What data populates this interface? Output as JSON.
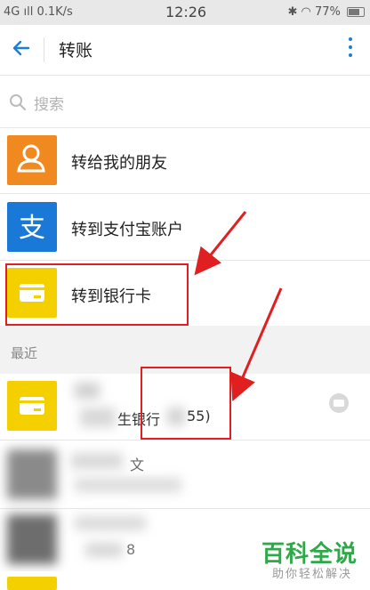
{
  "status_bar": {
    "left": "4G ıll 0.1K/s",
    "time": "12:26",
    "right": "77%"
  },
  "header": {
    "title": "转账"
  },
  "search": {
    "placeholder": "搜索"
  },
  "options": [
    {
      "label": "转给我的朋友",
      "icon": "person-icon",
      "color": "#f0891f"
    },
    {
      "label": "转到支付宝账户",
      "icon": "alipay-icon",
      "color": "#1a78d6"
    },
    {
      "label": "转到银行卡",
      "icon": "bank-card-icon",
      "color": "#f5d000"
    }
  ],
  "recent": {
    "heading": "最近",
    "items": [
      {
        "text": "生银行",
        "suffix": "55)",
        "icon": "bank-card-icon"
      },
      {
        "text": "文"
      },
      {
        "text": "8"
      },
      {
        "text": ""
      }
    ]
  },
  "watermark": {
    "title": "百科全说",
    "subtitle": "助你轻松解决"
  }
}
